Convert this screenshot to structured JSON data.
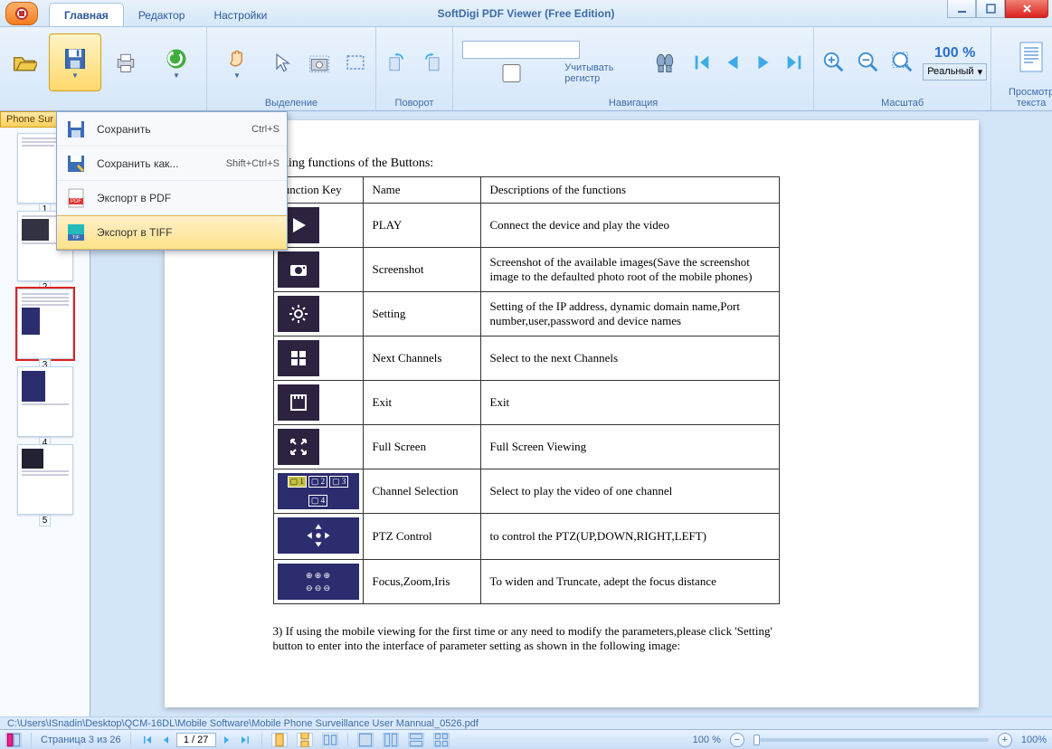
{
  "app": {
    "title": "SoftDigi PDF Viewer  (Free Edition)"
  },
  "tabs": {
    "main": "Главная",
    "editor": "Редактор",
    "settings": "Настройки"
  },
  "ribbon": {
    "group_select": "Выделение",
    "group_rotate": "Поворот",
    "group_nav": "Навигация",
    "group_zoom": "Масштаб",
    "search_checkbox": "Учитывать регистр",
    "zoom_pct": "100 %",
    "zoom_mode": "Реальный",
    "text_view": "Просмотр текста"
  },
  "save_menu": {
    "save": "Сохранить",
    "save_accel": "Ctrl+S",
    "save_as": "Сохранить как...",
    "save_as_accel": "Shift+Ctrl+S",
    "export_pdf": "Экспорт в PDF",
    "export_tiff": "Экспорт в TIFF"
  },
  "thumbs": {
    "tab_label": "Phone Sur",
    "pages": [
      "1",
      "2",
      "3",
      "4",
      "5"
    ],
    "selected": 3
  },
  "document": {
    "intro": "The corresponding functions of the Buttons:",
    "headers": {
      "fkey": "Function Key",
      "name": "Name",
      "desc": "Descriptions of the functions"
    },
    "rows": [
      {
        "name": "PLAY",
        "desc": "Connect the device and play the video"
      },
      {
        "name": "Screenshot",
        "desc": "Screenshot of the available images(Save the screenshot image to the defaulted photo root of the mobile phones)"
      },
      {
        "name": "Setting",
        "desc": "Setting of the IP address, dynamic domain name,Port number,user,password and device names"
      },
      {
        "name": "Next Channels",
        "desc": "Select to the next Channels"
      },
      {
        "name": "Exit",
        "desc": "Exit"
      },
      {
        "name": "Full Screen",
        "desc": "Full Screen Viewing"
      },
      {
        "name": "Channel Selection",
        "desc": "Select to play the video of one channel"
      },
      {
        "name": "PTZ Control",
        "desc": "to control the PTZ(UP,DOWN,RIGHT,LEFT)"
      },
      {
        "name": "Focus,Zoom,Iris",
        "desc": "To widen and Truncate, adept the focus distance"
      }
    ],
    "footnote": "3) If using the mobile viewing for the first time or any need to modify the parameters,please click 'Setting' button to enter into the interface of parameter setting as shown in the following image:"
  },
  "path": "C:\\Users\\ISnadin\\Desktop\\QCM-16DL\\Mobile Software\\Mobile Phone Surveillance User Mannual_0526.pdf",
  "status": {
    "page_text": "Страница 3 из 26",
    "page_input": "1 / 27",
    "zoom_left": "100 %",
    "zoom_right": "100%"
  }
}
